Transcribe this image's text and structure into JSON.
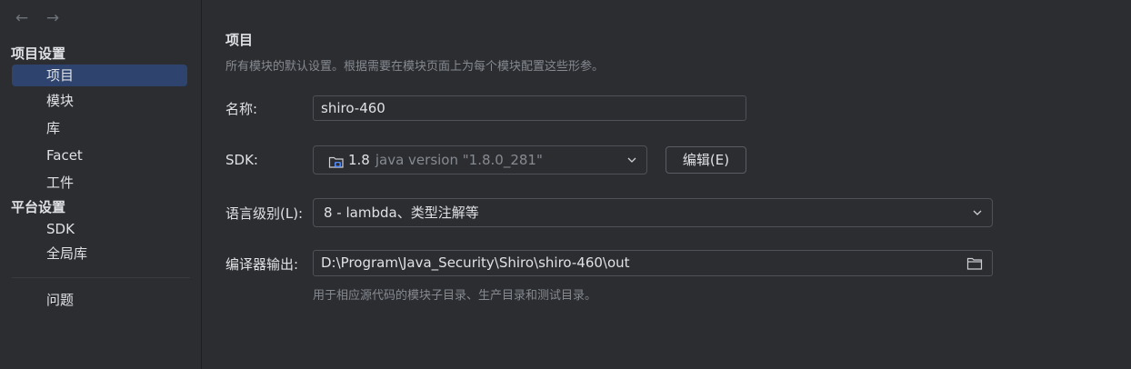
{
  "sidebar": {
    "nav": {
      "back_glyph": "←",
      "forward_glyph": "→"
    },
    "project_settings_header": "项目设置",
    "project_items": [
      {
        "label": "项目",
        "selected": true
      },
      {
        "label": "模块",
        "selected": false
      },
      {
        "label": "库",
        "selected": false
      },
      {
        "label": "Facet",
        "selected": false
      },
      {
        "label": "工件",
        "selected": false
      }
    ],
    "platform_settings_header": "平台设置",
    "platform_items": [
      {
        "label": "SDK"
      },
      {
        "label": "全局库"
      }
    ],
    "problems_label": "问题"
  },
  "main": {
    "title": "项目",
    "subtitle": "所有模块的默认设置。根据需要在模块页面上为每个模块配置这些形参。",
    "name_label": "名称:",
    "name_value": "shiro-460",
    "sdk_label": "SDK:",
    "sdk_version": "1.8",
    "sdk_detail": "java version \"1.8.0_281\"",
    "edit_button": "编辑(E)",
    "language_level_label": "语言级别(L):",
    "language_level_value": "8 - lambda、类型注解等",
    "compiler_output_label": "编译器输出:",
    "compiler_output_value": "D:\\Program\\Java_Security\\Shiro\\shiro-460\\out",
    "compiler_output_hint": "用于相应源代码的模块子目录、生产目录和测试目录。"
  },
  "colors": {
    "background": "#2b2d30",
    "selection": "#2e436e",
    "text": "#dfe1e5",
    "muted_text": "#868a91",
    "border": "#4e5157"
  }
}
